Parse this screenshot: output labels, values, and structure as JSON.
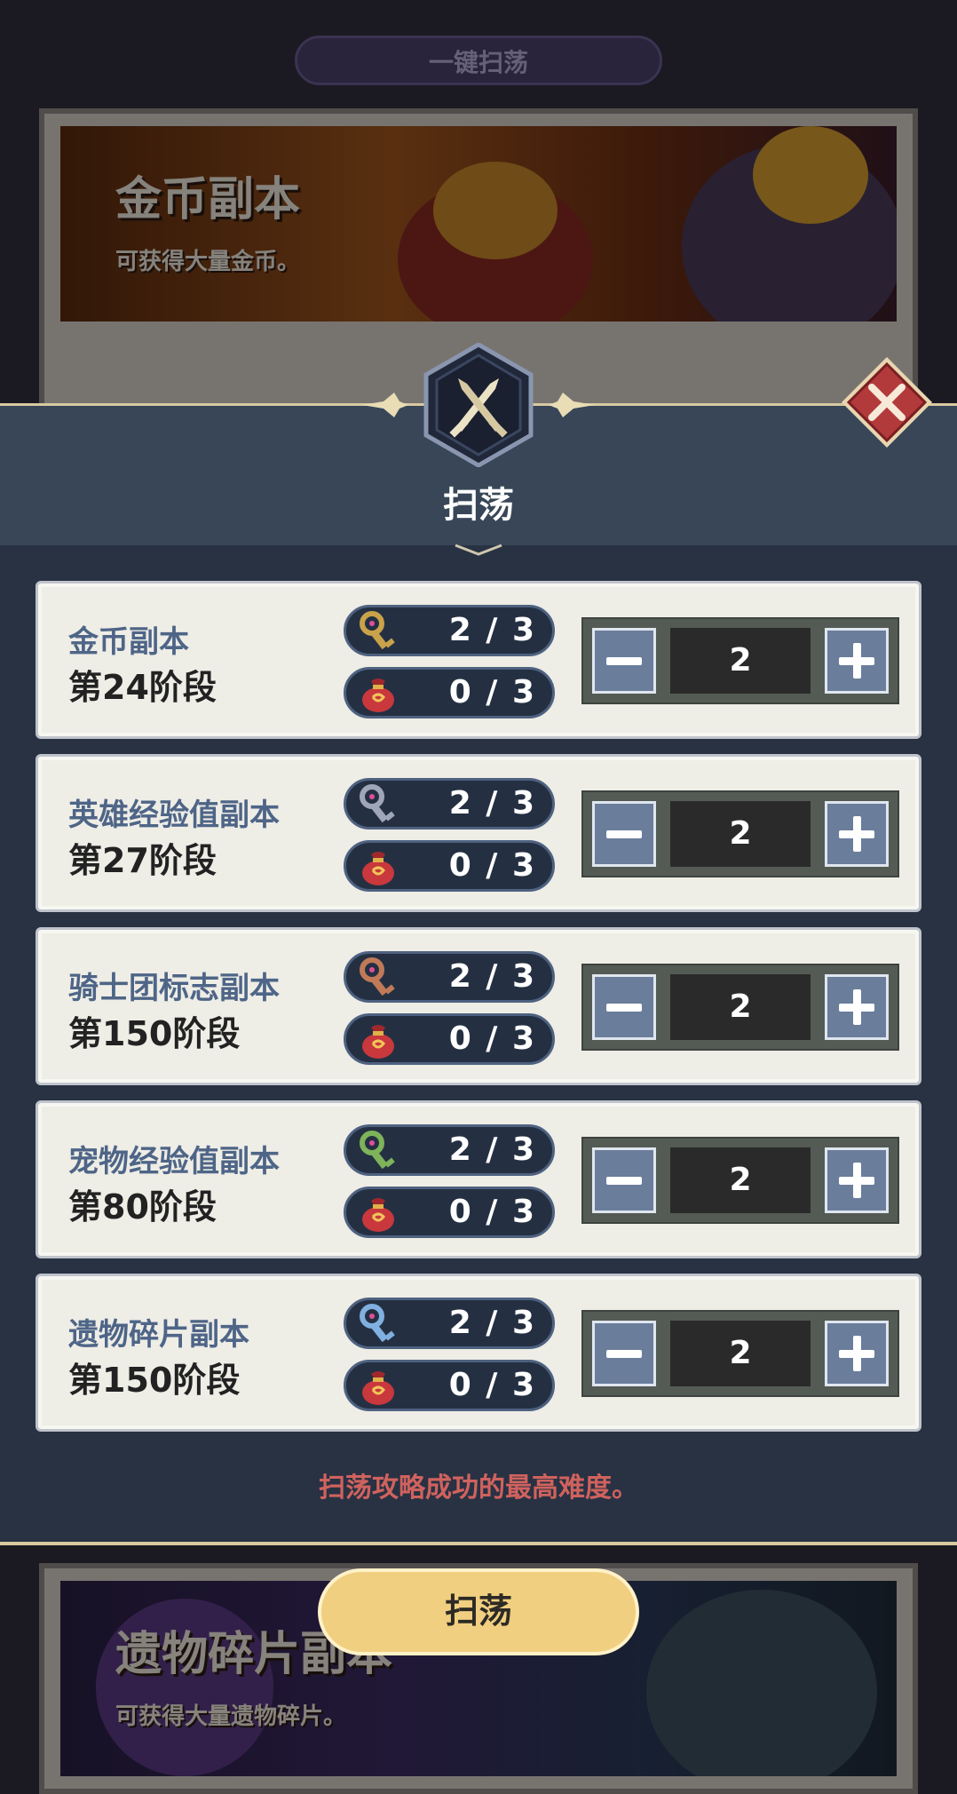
{
  "background": {
    "top_button": "一键扫荡",
    "cards": [
      {
        "title": "金币副本",
        "subtitle": "可获得大量金币。"
      },
      {
        "title": "遗物碎片副本",
        "subtitle": "可获得大量遗物碎片。"
      }
    ]
  },
  "modal": {
    "title": "扫荡",
    "hint": "扫荡攻略成功的最高难度。",
    "sweep_button": "扫荡"
  },
  "colors": {
    "key_gold": "#c9a24a",
    "key_silver": "#9fa6b8",
    "key_bronze": "#c07a58",
    "key_green": "#7eb35a",
    "key_blue": "#7fb0e0",
    "bag_red": "#c8383c",
    "accent_gold": "#f0cf80",
    "hint_red": "#d0625e"
  },
  "rows": [
    {
      "name": "金币副本",
      "stage": "第24阶段",
      "key_icon": "gold-key-icon",
      "key_count": "2 / 3",
      "bag_icon": "lucky-bag-icon",
      "bag_count": "0 / 3",
      "quantity": "2"
    },
    {
      "name": "英雄经验值副本",
      "stage": "第27阶段",
      "key_icon": "silver-key-icon",
      "key_count": "2 / 3",
      "bag_icon": "lucky-bag-icon",
      "bag_count": "0 / 3",
      "quantity": "2"
    },
    {
      "name": "骑士团标志副本",
      "stage": "第150阶段",
      "key_icon": "bronze-key-icon",
      "key_count": "2 / 3",
      "bag_icon": "lucky-bag-icon",
      "bag_count": "0 / 3",
      "quantity": "2"
    },
    {
      "name": "宠物经验值副本",
      "stage": "第80阶段",
      "key_icon": "green-key-icon",
      "key_count": "2 / 3",
      "bag_icon": "lucky-bag-icon",
      "bag_count": "0 / 3",
      "quantity": "2"
    },
    {
      "name": "遗物碎片副本",
      "stage": "第150阶段",
      "key_icon": "blue-key-icon",
      "key_count": "2 / 3",
      "bag_icon": "lucky-bag-icon",
      "bag_count": "0 / 3",
      "quantity": "2"
    }
  ]
}
